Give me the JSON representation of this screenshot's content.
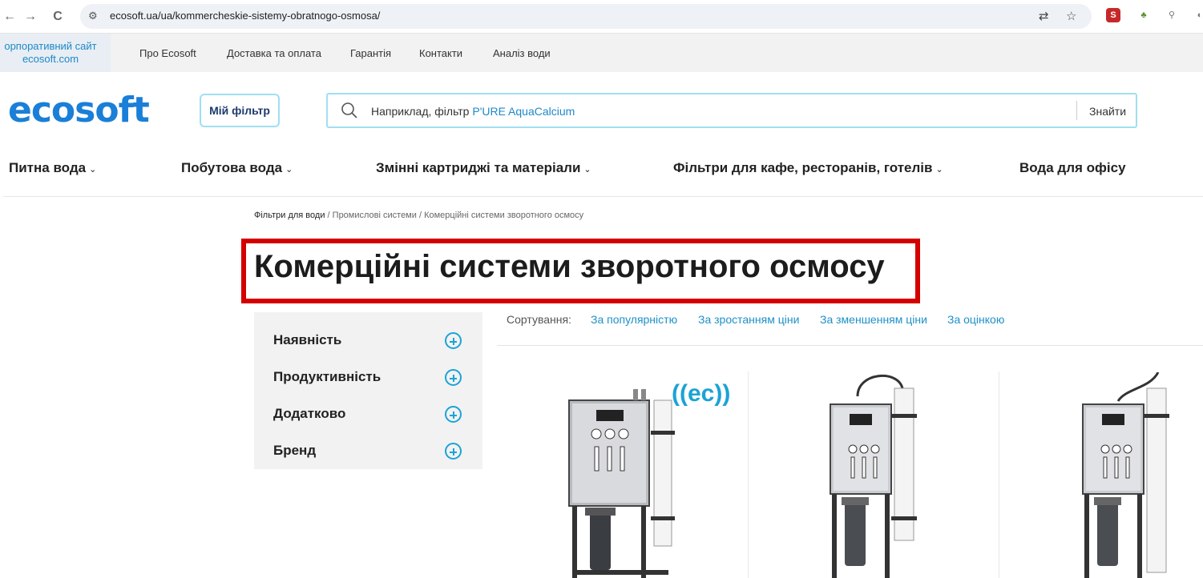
{
  "browser": {
    "url": "ecosoft.ua/ua/kommercheskie-sistemy-obratnogo-osmosa/",
    "back": "←",
    "forward": "→",
    "reload": "C"
  },
  "topbar": {
    "corporate_line1": "орпоративний сайт",
    "corporate_line2": "ecosoft.com",
    "links": [
      "Про Ecosoft",
      "Доставка та оплата",
      "Гарантія",
      "Контакти",
      "Аналіз води"
    ]
  },
  "header": {
    "logo": "ecosoft",
    "my_filter": "Мій фільтр",
    "search_placeholder_prefix": "Наприклад, фільтр ",
    "search_placeholder_highlight": "P'URE AquaCalcium",
    "search_button": "Знайти"
  },
  "menu": [
    {
      "label": "Питна вода",
      "has_dropdown": true
    },
    {
      "label": "Побутова вода",
      "has_dropdown": true
    },
    {
      "label": "Змінні картриджі та матеріали",
      "has_dropdown": true
    },
    {
      "label": "Фільтри для кафе, ресторанів, готелів",
      "has_dropdown": true
    },
    {
      "label": "Вода для офісу",
      "has_dropdown": false
    }
  ],
  "breadcrumb": {
    "items": [
      "Фільтри для води",
      "Промислові системи",
      "Комерційні системи зворотного осмосу"
    ],
    "separator": "/"
  },
  "page_title": "Комерційні системи зворотного осмосу",
  "filters": [
    "Наявність",
    "Продуктивність",
    "Додатково",
    "Бренд"
  ],
  "sorting": {
    "label": "Сортування:",
    "options": [
      "За популярністю",
      "За зростанням ціни",
      "За зменшенням ціни",
      "За оцінкою"
    ]
  },
  "product_badge": "((ec))",
  "colors": {
    "brand_blue": "#1a7fd8",
    "accent_cyan": "#1ba3d6",
    "highlight_red": "#d40000"
  }
}
